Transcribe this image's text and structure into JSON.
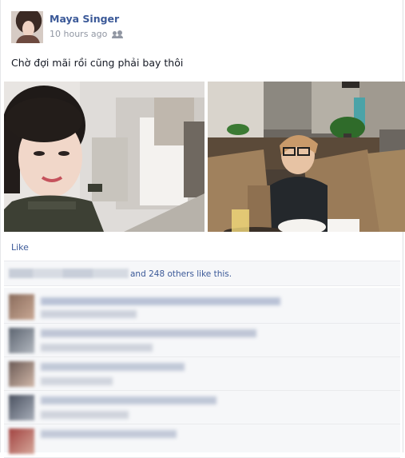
{
  "post": {
    "author": "Maya Singer",
    "time": "10 hours ago",
    "privacy_icon": "friends-icon",
    "status": "Chờ đợi mãi rồi cũng phải bay thôi"
  },
  "actions": {
    "like_label": "Like"
  },
  "likes": {
    "others_text": "and 248 others like this."
  },
  "photos": [
    "selfie-photo",
    "restaurant-photo"
  ],
  "colors": {
    "link": "#3b5998",
    "muted": "#9197a3",
    "panel": "#f6f7f9"
  }
}
